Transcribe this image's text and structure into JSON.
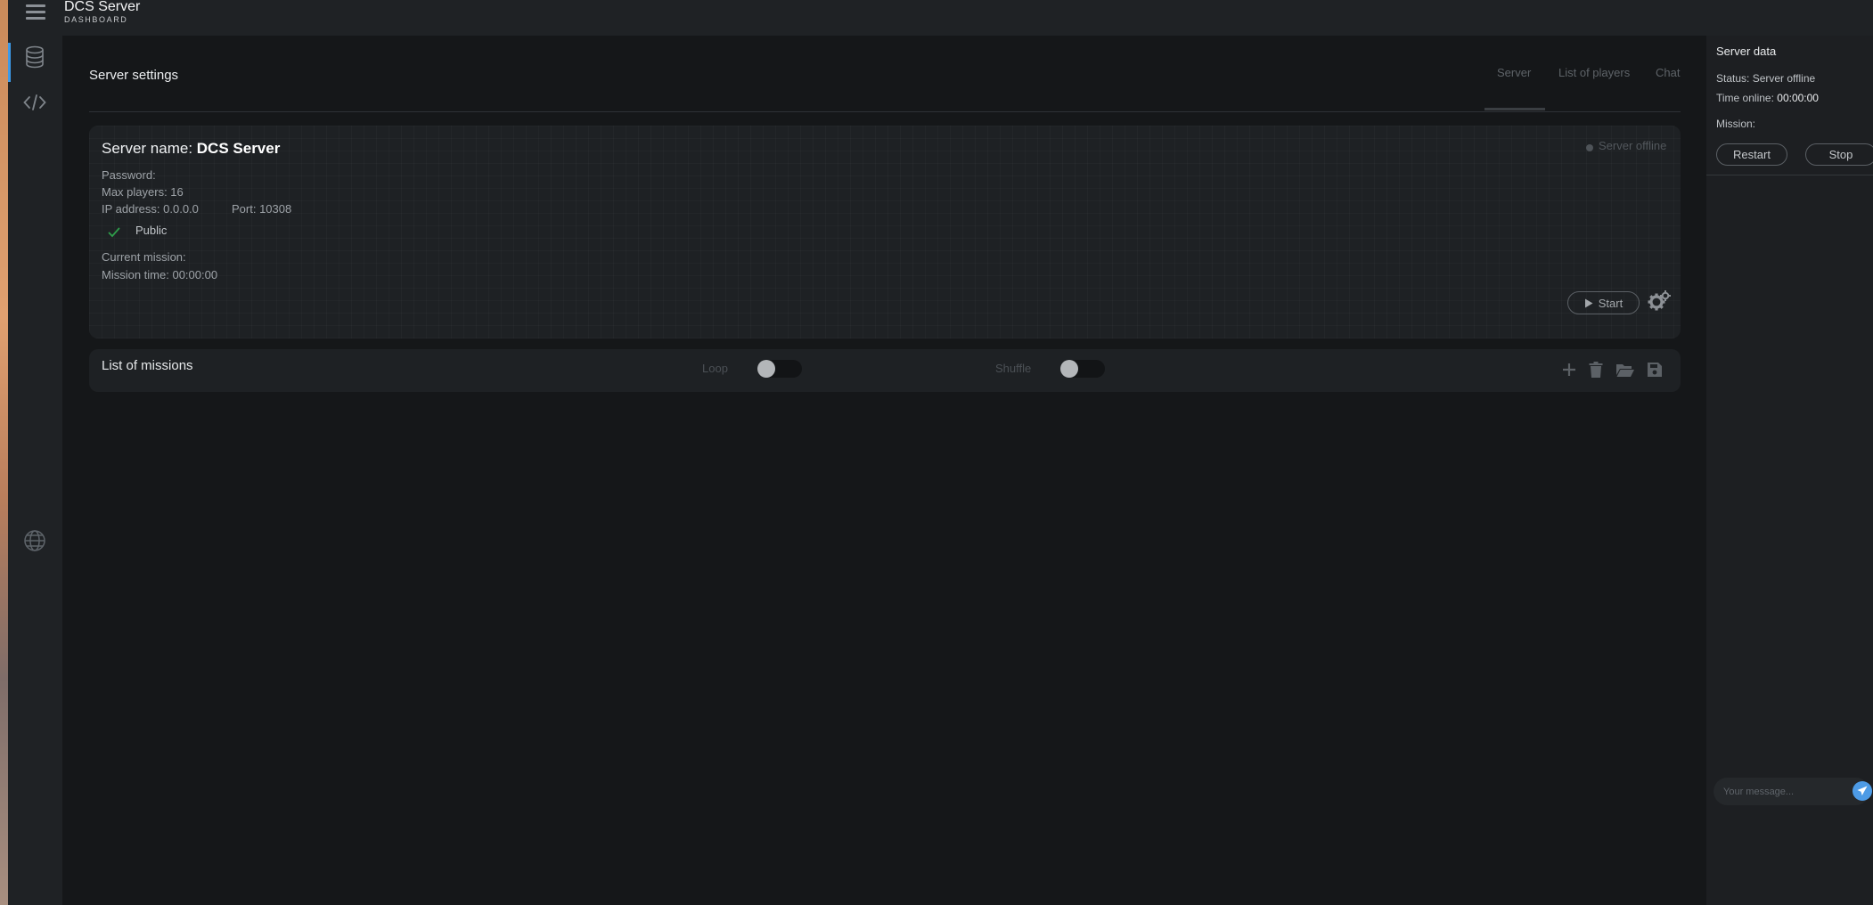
{
  "app": {
    "title": "DCS Server",
    "subtitle": "DASHBOARD"
  },
  "sidebar": {
    "items": [
      {
        "icon": "database-icon"
      },
      {
        "icon": "code-icon"
      },
      {
        "icon": "globe-icon"
      }
    ]
  },
  "main": {
    "title": "Server settings",
    "tabs": [
      {
        "label": "Server",
        "active": true
      },
      {
        "label": "List of players",
        "active": false
      },
      {
        "label": "Chat",
        "active": false
      }
    ]
  },
  "server": {
    "name_label": "Server name:",
    "name_value": "DCS Server",
    "password": "Password:",
    "max_players": "Max players: 16",
    "ip_address": "IP address: 0.0.0.0",
    "port": "Port: 10308",
    "public_label": "Public",
    "public_checked": true,
    "current_mission": "Current mission:",
    "mission_time": "Mission time: 00:00:00",
    "status": "Server offline",
    "start_label": "Start"
  },
  "missions": {
    "title": "List of missions",
    "loop_label": "Loop",
    "loop_on": false,
    "shuffle_label": "Shuffle",
    "shuffle_on": false,
    "actions": [
      "plus-icon",
      "trash-icon",
      "folder-open-icon",
      "save-icon"
    ]
  },
  "server_data": {
    "title": "Server data",
    "status": "Status: Server offline",
    "time_online_label": "Time online:",
    "time_online_value": "00:00:00",
    "mission": "Mission:",
    "restart_label": "Restart",
    "stop_label": "Stop"
  },
  "chat": {
    "placeholder": "Your message..."
  },
  "colors": {
    "accent": "#4d9be6",
    "background": "#151719",
    "panel": "#1f2225",
    "check_green": "#2e9c4a"
  }
}
